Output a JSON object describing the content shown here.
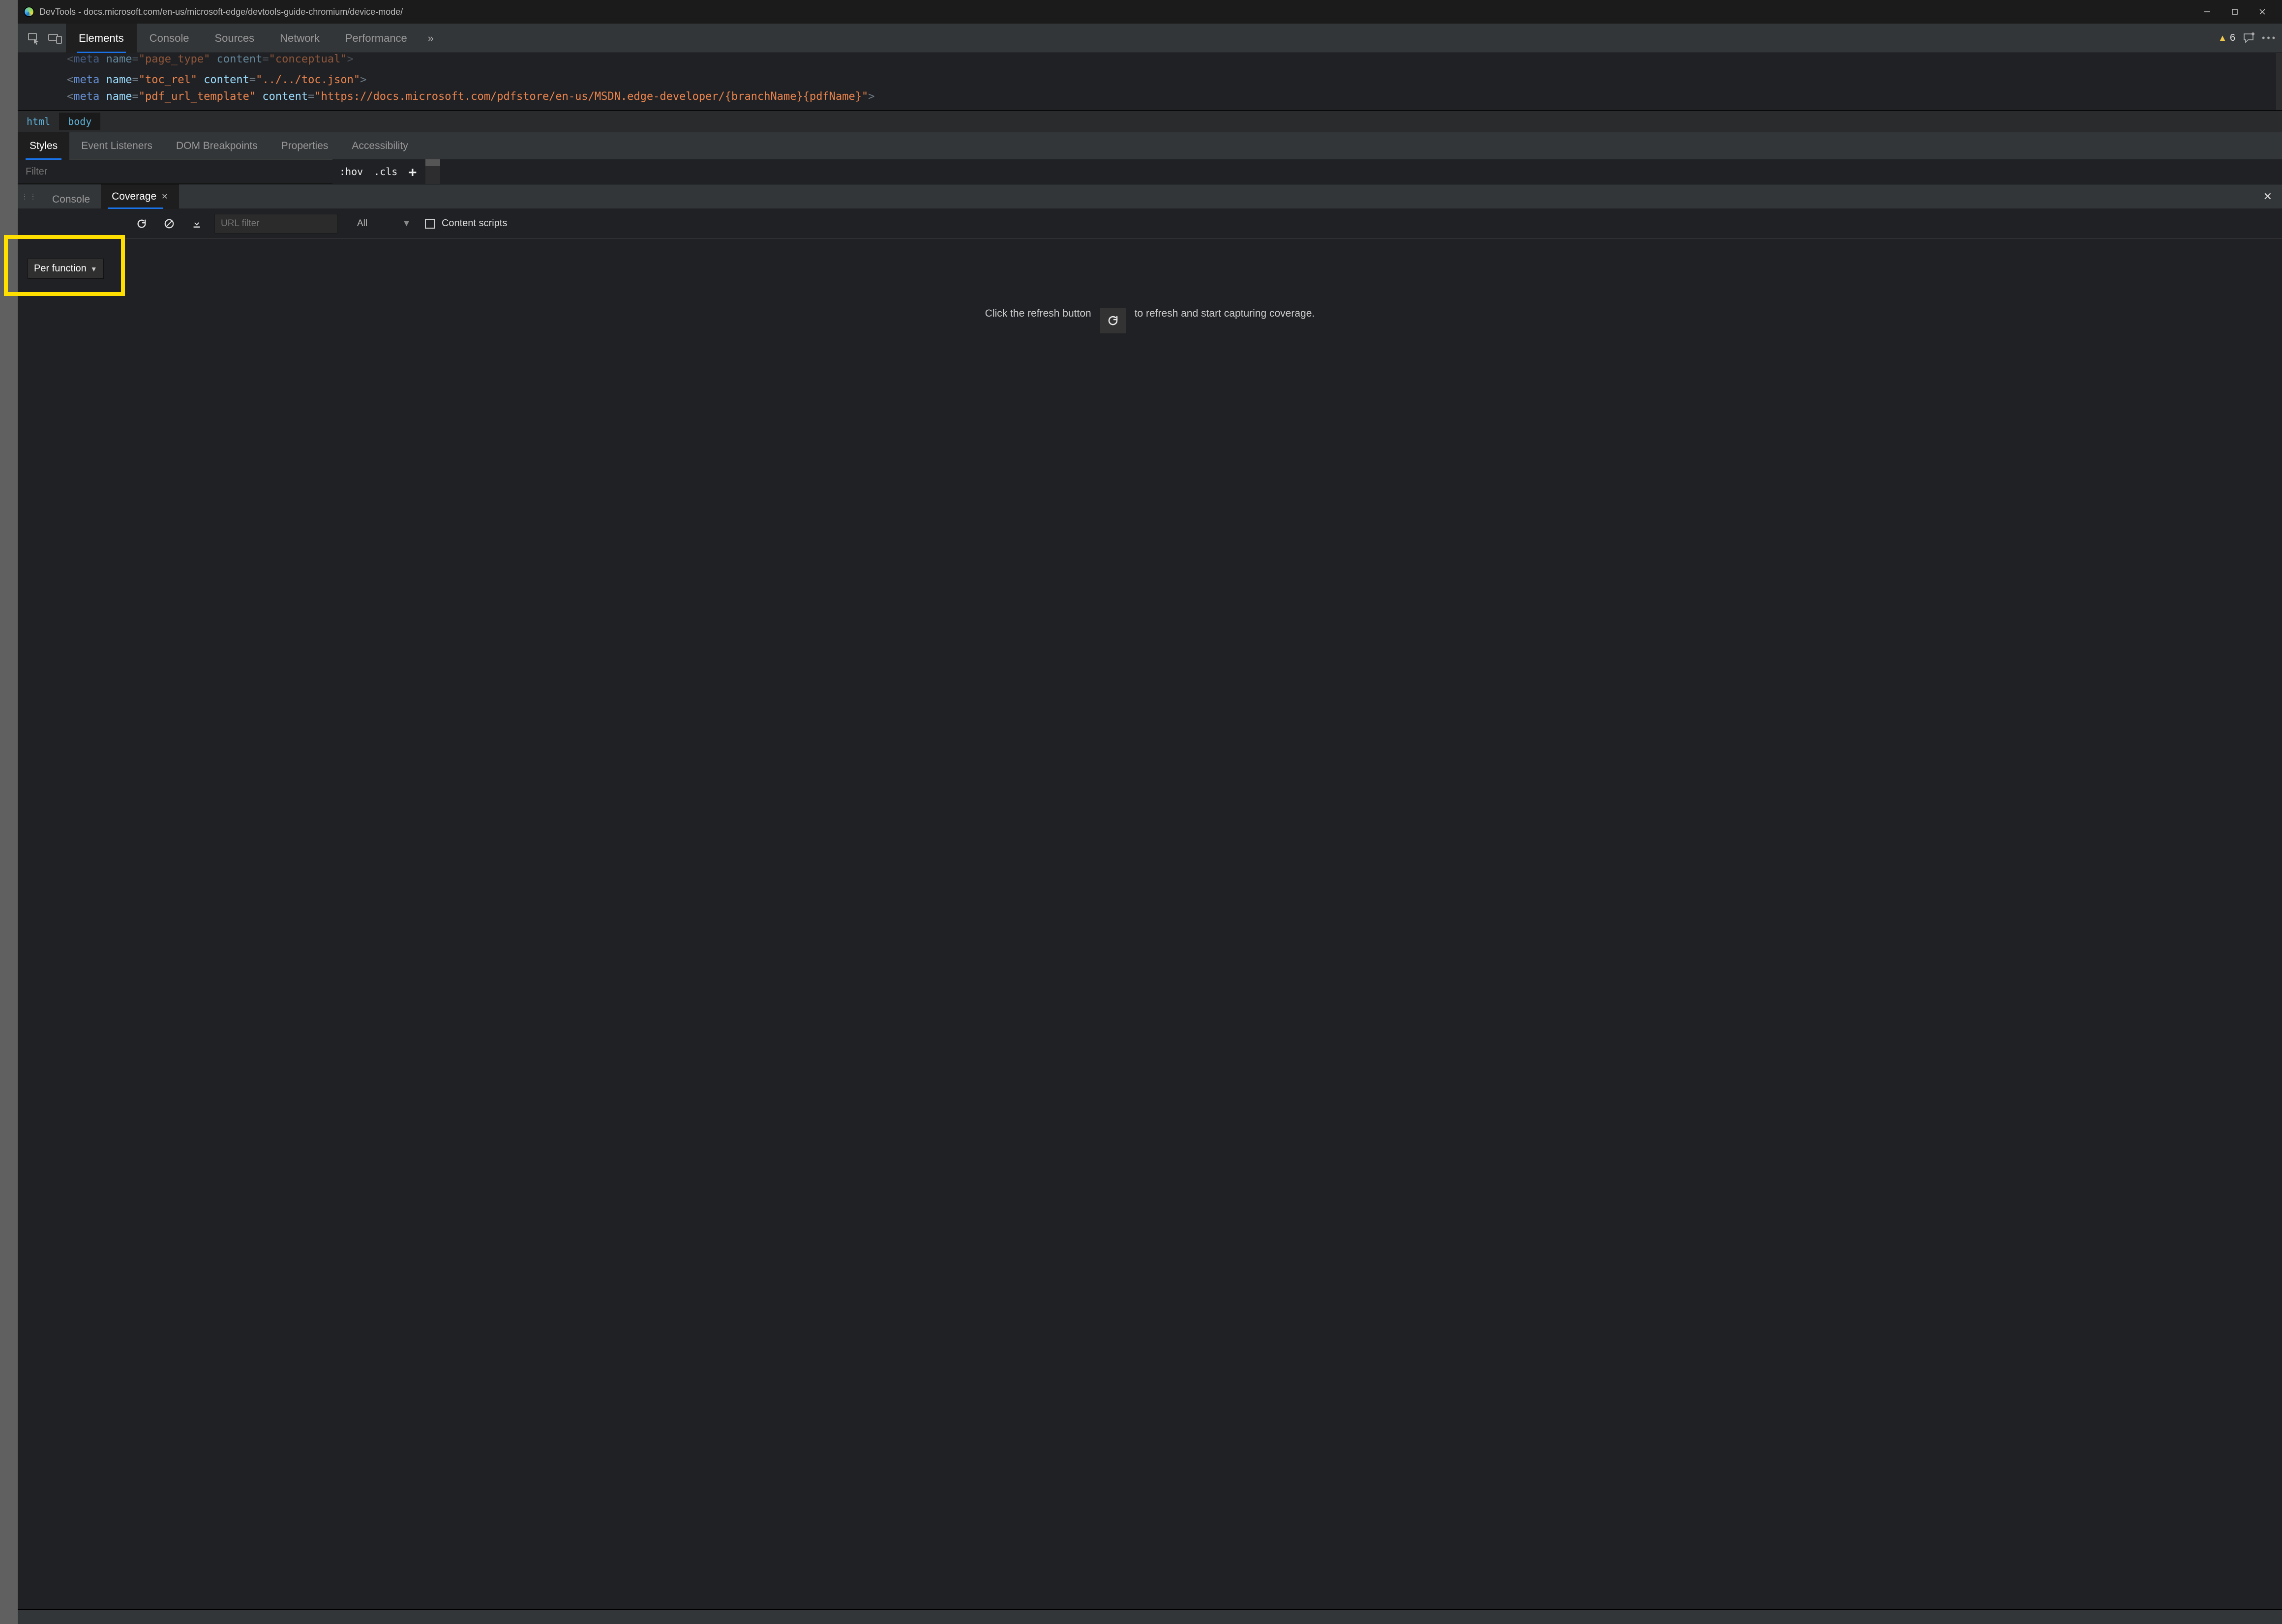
{
  "window": {
    "title": "DevTools - docs.microsoft.com/en-us/microsoft-edge/devtools-guide-chromium/device-mode/"
  },
  "toolbar": {
    "warning_count": "6",
    "tabs": {
      "elements": "Elements",
      "console": "Console",
      "sources": "Sources",
      "network": "Network",
      "performance": "Performance"
    }
  },
  "dom": {
    "line1": {
      "tag": "meta ",
      "attr1": "name",
      "val1": "\"page_type\"",
      "attr2": "content",
      "val2": "\"conceptual\""
    },
    "line2": {
      "tag": "meta ",
      "attr1": "name",
      "val1": "\"toc_rel\"",
      "attr2": "content",
      "val2": "\"../../toc.json\""
    },
    "line3": {
      "tag": "meta ",
      "attr1": "name",
      "val1": "\"pdf_url_template\"",
      "attr2": "content",
      "val2": "\"https://docs.microsoft.com/pdfstore/en-us/MSDN.edge-developer/{branchName}{pdfName}\""
    }
  },
  "breadcrumb": {
    "html": "html",
    "body": "body"
  },
  "subtabs": {
    "styles": "Styles",
    "event_listeners": "Event Listeners",
    "dom_breakpoints": "DOM Breakpoints",
    "properties": "Properties",
    "accessibility": "Accessibility"
  },
  "styles_filter": {
    "placeholder": "Filter",
    "hov": ":hov",
    "cls": ".cls"
  },
  "drawer": {
    "console": "Console",
    "coverage": "Coverage"
  },
  "coverage": {
    "mode": "Per function",
    "url_placeholder": "URL filter",
    "type_filter": "All",
    "content_scripts": "Content scripts",
    "hint_before": "Click the refresh button",
    "hint_after": "to refresh and start capturing coverage."
  }
}
